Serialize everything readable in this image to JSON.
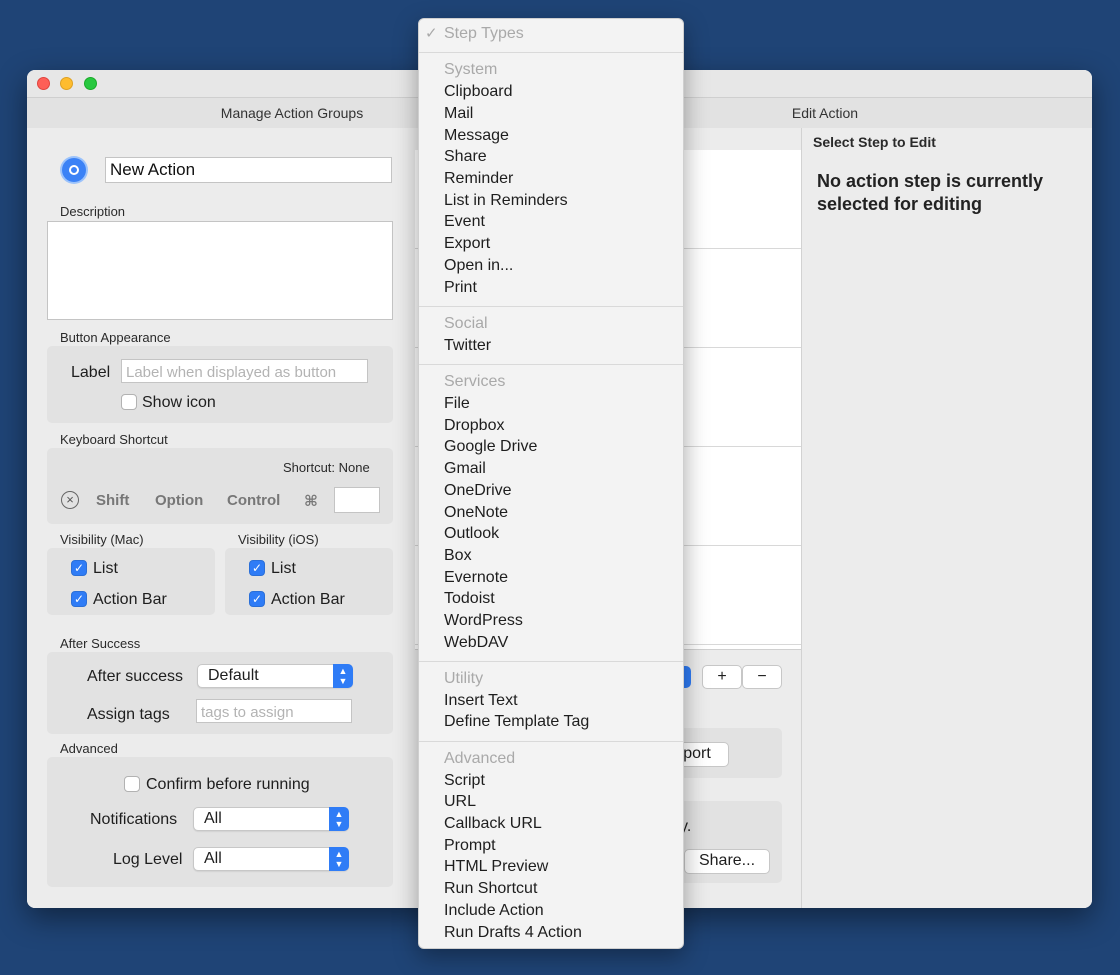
{
  "window": {
    "tabs": {
      "left": "Manage Action Groups",
      "right": "Edit Action"
    }
  },
  "action": {
    "name": "New Action",
    "description_label": "Description",
    "description_value": ""
  },
  "button_appearance": {
    "section": "Button Appearance",
    "label": "Label",
    "label_placeholder": "Label when displayed as button",
    "show_icon": "Show icon"
  },
  "keyboard_shortcut": {
    "section": "Keyboard Shortcut",
    "shortcut_text": "Shortcut: None",
    "modifiers": {
      "shift": "Shift",
      "option": "Option",
      "control": "Control",
      "command": "⌘"
    }
  },
  "visibility_mac": {
    "section": "Visibility (Mac)",
    "list": "List",
    "action_bar": "Action Bar"
  },
  "visibility_ios": {
    "section": "Visibility (iOS)",
    "list": "List",
    "action_bar": "Action Bar"
  },
  "after_success": {
    "section": "After Success",
    "after_success_label": "After success",
    "after_success_value": "Default",
    "assign_tags_label": "Assign tags",
    "assign_tags_placeholder": "tags to assign"
  },
  "advanced": {
    "section": "Advanced",
    "confirm": "Confirm before running",
    "notifications_label": "Notifications",
    "notifications_value": "All",
    "log_level_label": "Log Level",
    "log_level_value": "All"
  },
  "middle": {
    "add": "+",
    "remove": "−",
    "import_partial": "port",
    "text_partial": "y.",
    "share": "Share..."
  },
  "right": {
    "header": "Select Step to Edit",
    "message": "No action step is currently selected for editing"
  },
  "menu": {
    "title": "Step Types",
    "check": "✓",
    "system": {
      "header": "System",
      "items": [
        "Clipboard",
        "Mail",
        "Message",
        "Share",
        "Reminder",
        "List in Reminders",
        "Event",
        "Export",
        "Open in...",
        "Print"
      ]
    },
    "social": {
      "header": "Social",
      "items": [
        "Twitter"
      ]
    },
    "services": {
      "header": "Services",
      "items": [
        "File",
        "Dropbox",
        "Google Drive",
        "Gmail",
        "OneDrive",
        "OneNote",
        "Outlook",
        "Box",
        "Evernote",
        "Todoist",
        "WordPress",
        "WebDAV"
      ]
    },
    "utility": {
      "header": "Utility",
      "items": [
        "Insert Text",
        "Define Template Tag"
      ]
    },
    "advanced": {
      "header": "Advanced",
      "items": [
        "Script",
        "URL",
        "Callback URL",
        "Prompt",
        "HTML Preview",
        "Run Shortcut",
        "Include Action",
        "Run Drafts 4 Action"
      ]
    }
  }
}
